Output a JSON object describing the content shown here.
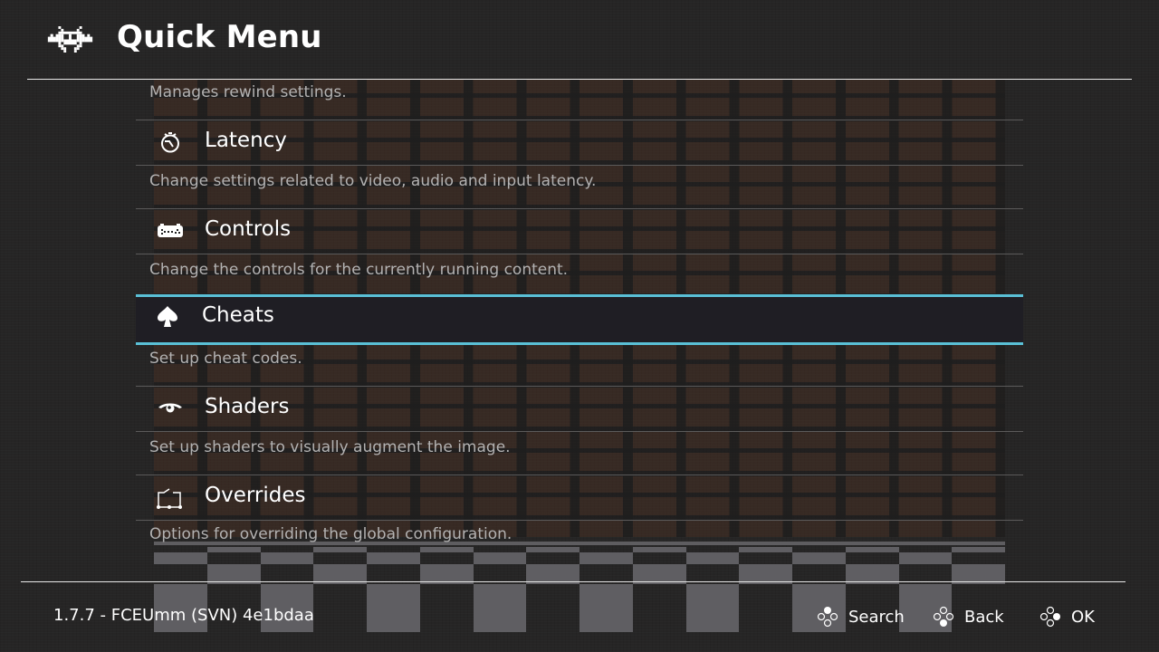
{
  "header": {
    "title": "Quick Menu",
    "logo_icon": "retroarch-invader-icon"
  },
  "menu": {
    "partial_top_sublabel": "Manages rewind settings.",
    "items": [
      {
        "label": "Latency",
        "sublabel": "Change settings related to video, audio and input latency.",
        "icon": "stopwatch-icon",
        "selected": false
      },
      {
        "label": "Controls",
        "sublabel": "Change the controls for the currently running content.",
        "icon": "gamepad-icon",
        "selected": false
      },
      {
        "label": "Cheats",
        "sublabel": "Set up cheat codes.",
        "icon": "spade-icon",
        "selected": true
      },
      {
        "label": "Shaders",
        "sublabel": "Set up shaders to visually augment the image.",
        "icon": "eye-icon",
        "selected": false
      },
      {
        "label": "Overrides",
        "sublabel": "Options for overriding the global configuration.",
        "icon": "overrides-icon",
        "selected": false
      }
    ]
  },
  "footer": {
    "version": "1.7.7 - FCEUmm (SVN) 4e1bdaa",
    "buttons": [
      {
        "label": "Search",
        "icon": "face-button-top-icon"
      },
      {
        "label": "Back",
        "icon": "face-button-bottom-icon"
      },
      {
        "label": "OK",
        "icon": "face-button-right-icon"
      }
    ]
  },
  "colors": {
    "accent": "#5ac0d6",
    "background": "#252424",
    "selected_row": "#1f1e24",
    "sublabel": "#b3b2b2"
  }
}
